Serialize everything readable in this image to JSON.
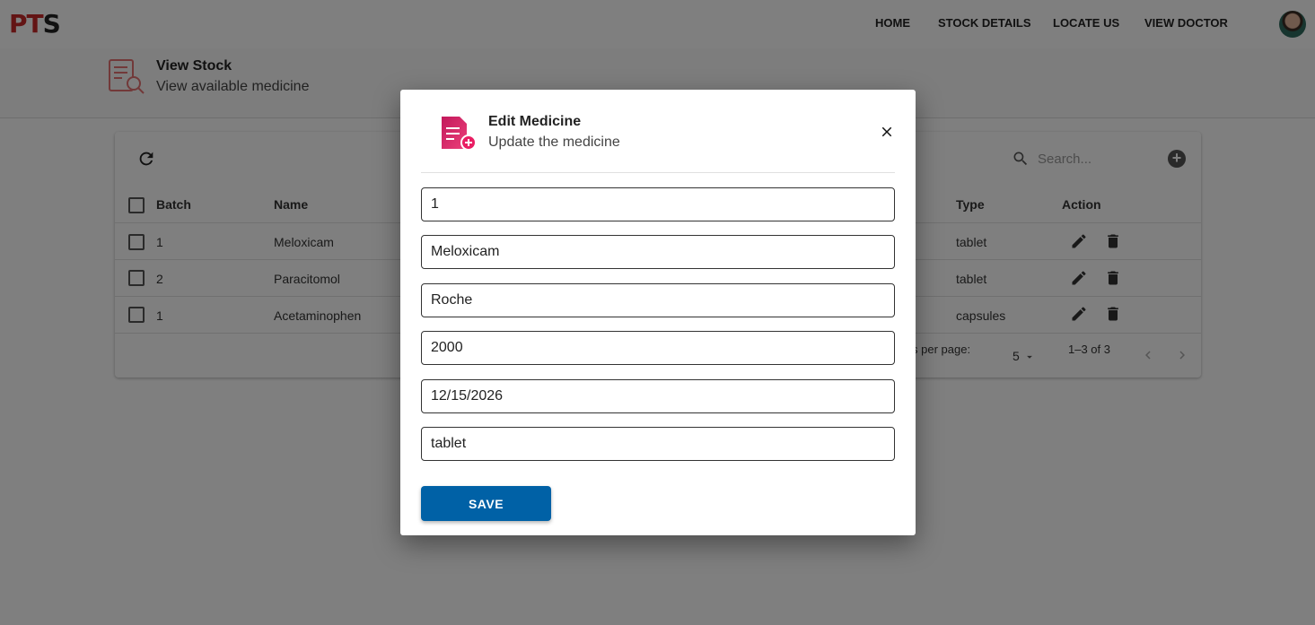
{
  "app": {
    "logo_part1": "PT",
    "logo_part2": "S"
  },
  "nav": {
    "items": [
      {
        "label": "HOME"
      },
      {
        "label": "STOCK DETAILS"
      },
      {
        "label": "LOCATE US"
      },
      {
        "label": "VIEW DOCTOR"
      }
    ]
  },
  "page": {
    "title": "View Stock",
    "subtitle": "View available medicine"
  },
  "table": {
    "search_placeholder": "Search...",
    "columns": [
      "Batch",
      "Name",
      "Type",
      "Action"
    ],
    "rows": [
      {
        "batch": "1",
        "name": "Meloxicam",
        "type": "tablet"
      },
      {
        "batch": "2",
        "name": "Paracitomol",
        "type": "tablet"
      },
      {
        "batch": "1",
        "name": "Acetaminophen",
        "type": "capsules"
      }
    ],
    "footer": {
      "rows_per_page_label": "Rows per page:",
      "rows_per_page_value": "5",
      "range": "1–3 of 3"
    }
  },
  "modal": {
    "title": "Edit Medicine",
    "subtitle": "Update the medicine",
    "fields": [
      {
        "value": "1"
      },
      {
        "value": "Meloxicam"
      },
      {
        "value": "Roche"
      },
      {
        "value": "2000"
      },
      {
        "value": "12/15/2026"
      },
      {
        "value": "tablet"
      }
    ],
    "save_label": "SAVE"
  },
  "colors": {
    "primary_button": "#0061a6",
    "logo_red": "#c62828",
    "icon_pink": "#d81b60"
  }
}
